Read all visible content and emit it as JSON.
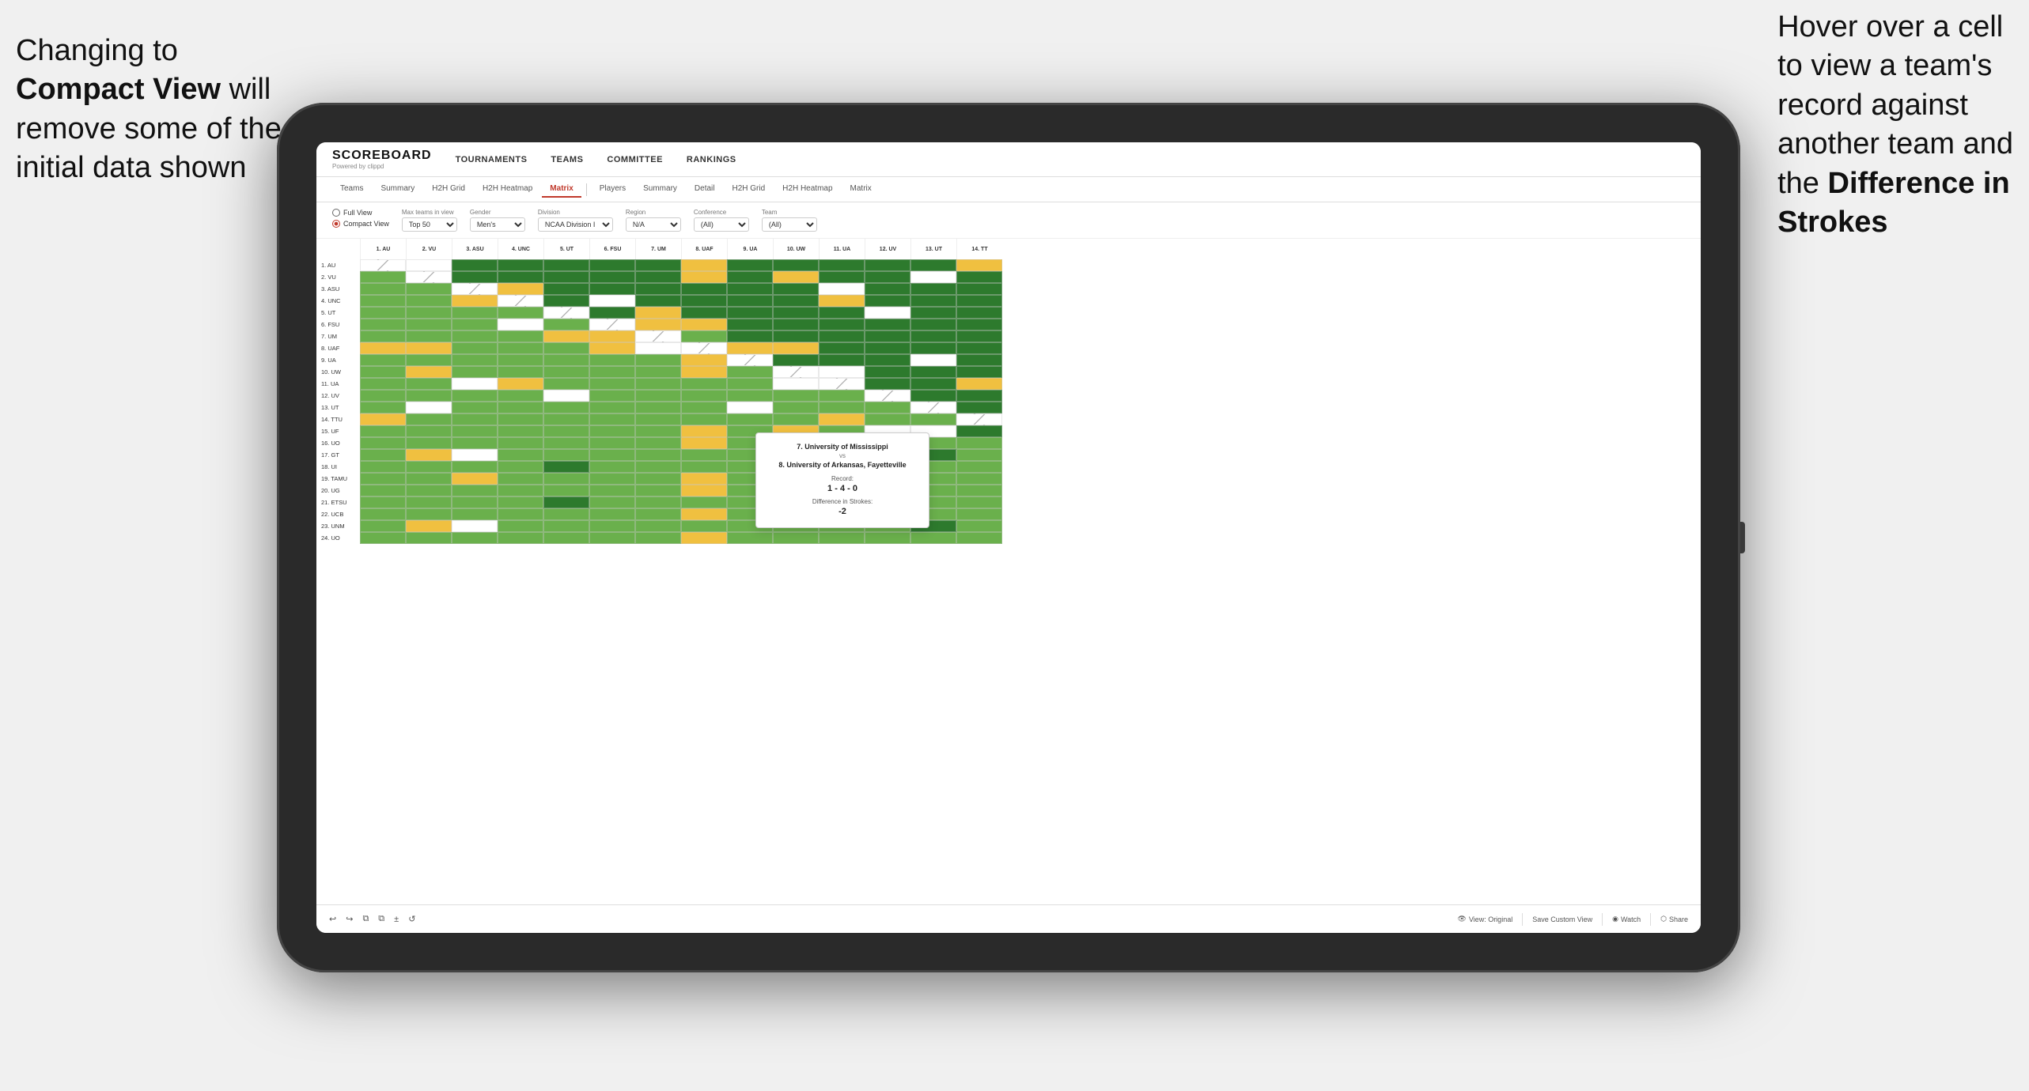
{
  "annotation_left": {
    "line1": "Changing to",
    "line2_bold": "Compact View",
    "line2_rest": " will",
    "line3": "remove some of the",
    "line4": "initial data shown"
  },
  "annotation_right": {
    "line1": "Hover over a cell",
    "line2": "to view a team's",
    "line3": "record against",
    "line4": "another team and",
    "line5_pre": "the ",
    "line5_bold": "Difference in",
    "line6_bold": "Strokes"
  },
  "nav": {
    "logo": "SCOREBOARD",
    "logo_sub": "Powered by clippd",
    "links": [
      "TOURNAMENTS",
      "TEAMS",
      "COMMITTEE",
      "RANKINGS"
    ]
  },
  "sub_nav": {
    "group1": [
      "Teams",
      "Summary",
      "H2H Grid",
      "H2H Heatmap",
      "Matrix"
    ],
    "group2": [
      "Players",
      "Summary",
      "Detail",
      "H2H Grid",
      "H2H Heatmap",
      "Matrix"
    ],
    "active": "Matrix"
  },
  "controls": {
    "view_full": "Full View",
    "view_compact": "Compact View",
    "filters": [
      {
        "label": "Max teams in view",
        "value": "Top 50"
      },
      {
        "label": "Gender",
        "value": "Men's"
      },
      {
        "label": "Division",
        "value": "NCAA Division I"
      },
      {
        "label": "Region",
        "value": "N/A"
      },
      {
        "label": "Conference",
        "value": "(All)"
      },
      {
        "label": "Team",
        "value": "(All)"
      }
    ]
  },
  "col_headers": [
    "1. AU",
    "2. VU",
    "3. ASU",
    "4. UNC",
    "5. UT",
    "6. FSU",
    "7. UM",
    "8. UAF",
    "9. UA",
    "10. UW",
    "11. UA",
    "12. UV",
    "13. UT",
    "14. TT"
  ],
  "row_labels": [
    "1. AU",
    "2. VU",
    "3. ASU",
    "4. UNC",
    "5. UT",
    "6. FSU",
    "7. UM",
    "8. UAF",
    "9. UA",
    "10. UW",
    "11. UA",
    "12. UV",
    "13. UT",
    "14. TTU",
    "15. UF",
    "16. UO",
    "17. GT",
    "18. UI",
    "19. TAMU",
    "20. UG",
    "21. ETSU",
    "22. UCB",
    "23. UNM",
    "24. UO"
  ],
  "tooltip": {
    "team1": "7. University of Mississippi",
    "vs": "vs",
    "team2": "8. University of Arkansas, Fayetteville",
    "record_label": "Record:",
    "record_value": "1 - 4 - 0",
    "strokes_label": "Difference in Strokes:",
    "strokes_value": "-2"
  },
  "toolbar": {
    "undo": "↩",
    "redo": "↪",
    "icon1": "⧉",
    "icon2": "⧉",
    "icon3": "±",
    "icon4": "↺",
    "view_original": "View: Original",
    "save_custom": "Save Custom View",
    "watch": "Watch",
    "share": "Share"
  }
}
